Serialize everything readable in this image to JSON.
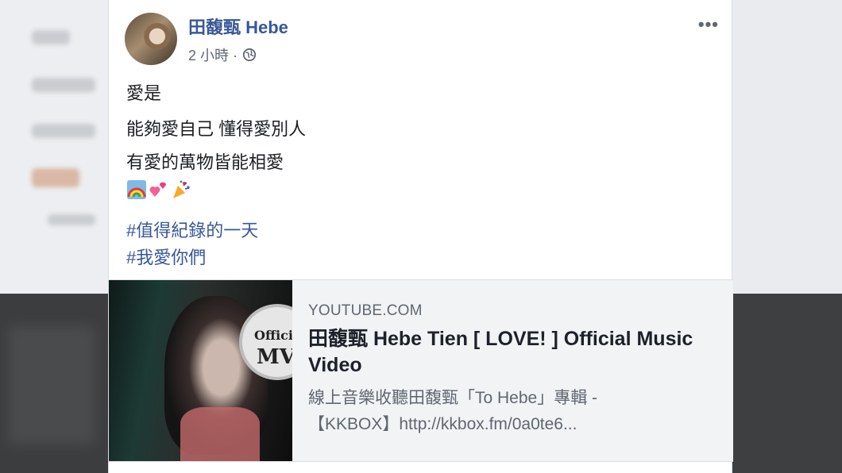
{
  "post": {
    "author": "田馥甄 Hebe",
    "time": "2 小時 ·",
    "privacy_icon": "globe-icon",
    "more_label": "•••",
    "lines": [
      "愛是",
      "能夠愛自己 懂得愛別人",
      "有愛的萬物皆能相愛"
    ],
    "emoji": [
      "rainbow",
      "two-hearts",
      "party-popper"
    ],
    "hashtags": [
      "#值得紀錄的一天",
      "#我愛你們"
    ]
  },
  "link_preview": {
    "thumbnail_badge_top": "Official",
    "thumbnail_badge_bottom": "MV",
    "source": "YOUTUBE.COM",
    "title": "田馥甄 Hebe Tien [ LOVE! ] Official Music Video",
    "description_line1": "線上音樂收聽田馥甄「To Hebe」專輯 -",
    "description_line2": "【KKBOX】http://kkbox.fm/0a0te6..."
  },
  "colors": {
    "link_blue": "#385898",
    "meta_gray": "#606770",
    "preview_bg": "#f2f3f5"
  }
}
